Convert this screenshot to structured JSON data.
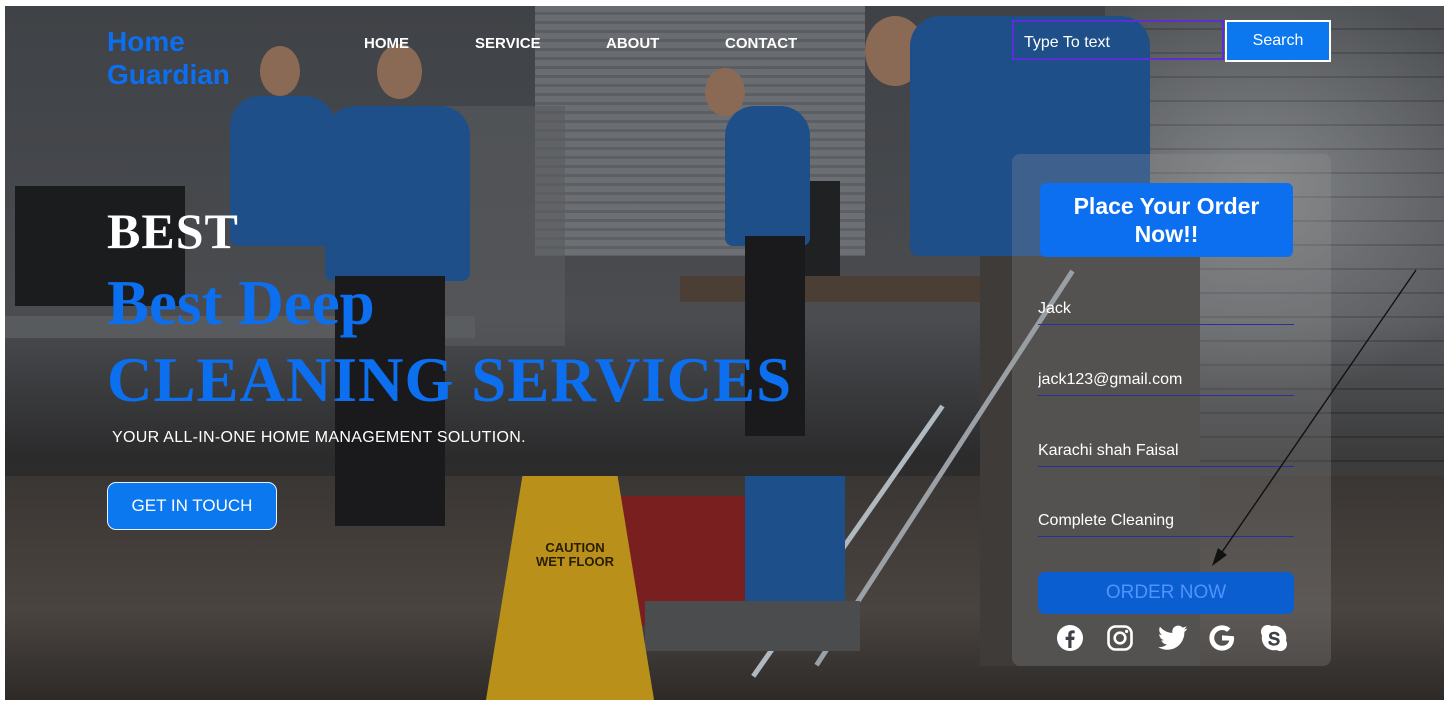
{
  "logo": {
    "line1": "Home",
    "line2": "Guardian"
  },
  "nav": [
    {
      "label": "HOME"
    },
    {
      "label": "SERVICE"
    },
    {
      "label": "ABOUT"
    },
    {
      "label": "CONTACT"
    }
  ],
  "search": {
    "value": "Type To text",
    "button_label": "Search"
  },
  "hero": {
    "kicker": "BEST",
    "headline_line1": "Best Deep",
    "headline_line2": "CLEANING SERVICES",
    "subtitle": "YOUR ALL-IN-ONE HOME MANAGEMENT SOLUTION.",
    "cta_label": "GET IN TOUCH"
  },
  "background_sign": {
    "line1": "CAUTION",
    "line2": "WET FLOOR"
  },
  "order_form": {
    "title": "Place Your Order Now!!",
    "fields": [
      {
        "value": "Jack"
      },
      {
        "value": "jack123@gmail.com"
      },
      {
        "value": "Karachi shah Faisal"
      },
      {
        "value": "Complete Cleaning"
      }
    ],
    "submit_label": "ORDER NOW",
    "socials": [
      "facebook-icon",
      "instagram-icon",
      "twitter-icon",
      "google-icon",
      "skype-icon"
    ]
  },
  "colors": {
    "brand_blue": "#0b6ff0",
    "search_border": "#5a2fd6",
    "field_underline": "#2b2f9a"
  }
}
